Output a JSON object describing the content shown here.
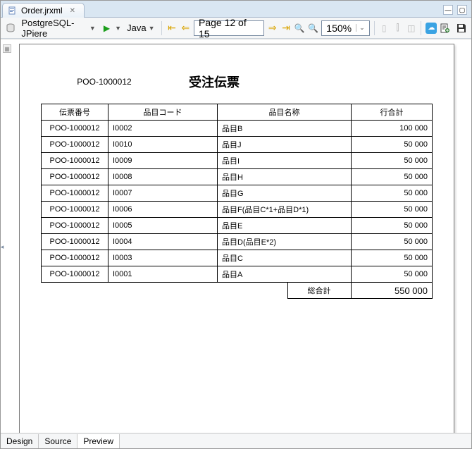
{
  "tab": {
    "title": "Order.jrxml"
  },
  "toolbar": {
    "datasource": "PostgreSQL-JPiere",
    "language": "Java",
    "page_label": "Page 12 of 15",
    "zoom": "150%"
  },
  "report": {
    "doc_no": "POO-1000012",
    "title": "受注伝票",
    "headers": {
      "slip": "伝票番号",
      "code": "品目コード",
      "name": "品目名称",
      "amount": "行合計"
    },
    "rows": [
      {
        "slip": "POO-1000012",
        "code": "I0002",
        "name": "品目B",
        "amount": "100 000"
      },
      {
        "slip": "POO-1000012",
        "code": "I0010",
        "name": "品目J",
        "amount": "50 000"
      },
      {
        "slip": "POO-1000012",
        "code": "I0009",
        "name": "品目I",
        "amount": "50 000"
      },
      {
        "slip": "POO-1000012",
        "code": "I0008",
        "name": "品目H",
        "amount": "50 000"
      },
      {
        "slip": "POO-1000012",
        "code": "I0007",
        "name": "品目G",
        "amount": "50 000"
      },
      {
        "slip": "POO-1000012",
        "code": "I0006",
        "name": "品目F(品目C*1+品目D*1)",
        "amount": "50 000"
      },
      {
        "slip": "POO-1000012",
        "code": "I0005",
        "name": "品目E",
        "amount": "50 000"
      },
      {
        "slip": "POO-1000012",
        "code": "I0004",
        "name": "品目D(品目E*2)",
        "amount": "50 000"
      },
      {
        "slip": "POO-1000012",
        "code": "I0003",
        "name": "品目C",
        "amount": "50 000"
      },
      {
        "slip": "POO-1000012",
        "code": "I0001",
        "name": "品目A",
        "amount": "50 000"
      }
    ],
    "total_label": "総合計",
    "total_value": "550 000"
  },
  "bottom_tabs": {
    "design": "Design",
    "source": "Source",
    "preview": "Preview"
  }
}
